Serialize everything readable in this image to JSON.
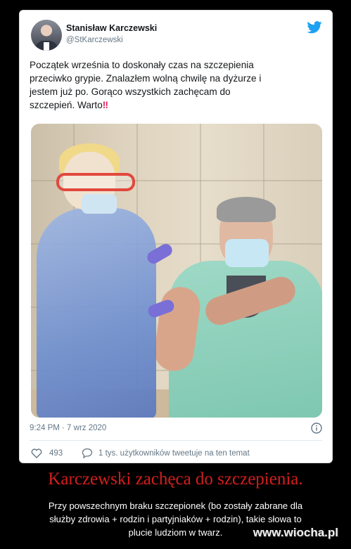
{
  "tweet": {
    "display_name": "Stanisław Karczewski",
    "handle": "@StKarczewski",
    "text": "Początek września  to doskonały czas na szczepienia\nprzeciwko grypie. Znalazłem wolną chwilę na dyżurze i\njestem już po.  Gorąco wszystkich zachęcam do\nszczepień. Warto",
    "emphasis": "‼",
    "timestamp": "9:24 PM · 7 wrz 2020",
    "like_count": "493",
    "reply_text": "1 tys. użytkowników tweetuje na ten temat",
    "colors": {
      "twitter_blue": "#1da1f2",
      "like_red": "#e0245e",
      "muted": "#657786"
    }
  },
  "caption": {
    "title": "Karczewski zachęca do szczepienia.",
    "body": "Przy powszechnym braku szczepionek (bo zostały zabrane dla\nsłużby zdrowia + rodzin i partyjniaków + rodzin), takie słowa to\nplucie ludziom w twarz.",
    "title_color": "#d41e1e"
  },
  "watermark": "www.wiocha.pl"
}
